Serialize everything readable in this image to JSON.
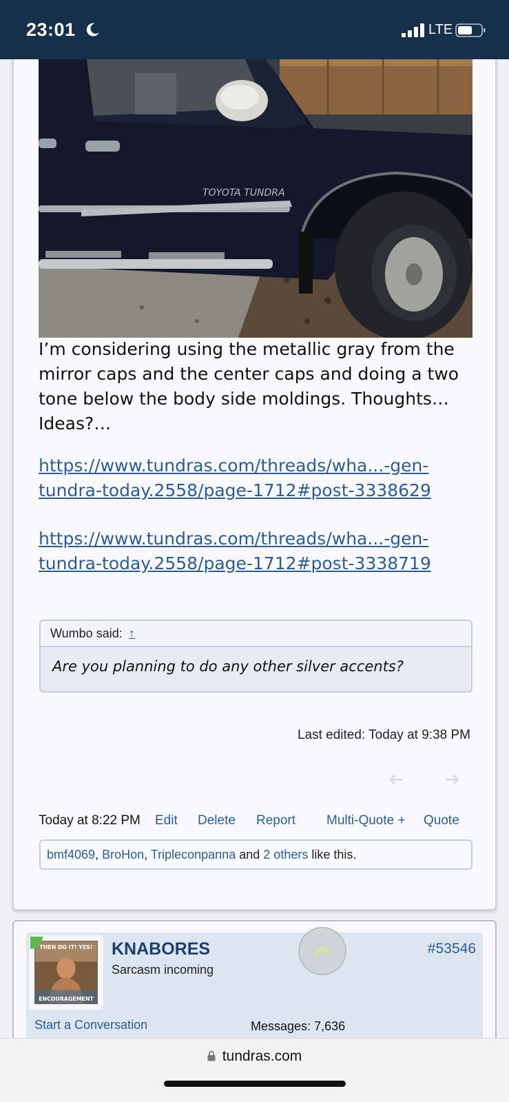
{
  "status_bar": {
    "time": "23:01",
    "network": "LTE"
  },
  "post": {
    "body": "I’m considering using the metallic gray from the mirror caps and the center caps and doing a two tone below the body side moldings. Thoughts… Ideas?…",
    "links": [
      "https://www.tundras.com/threads/wha...-gen-tundra-today.2558/page-1712#post-3338629",
      "https://www.tundras.com/threads/wha...-gen-tundra-today.2558/page-1712#post-3338719"
    ],
    "photo_badge": "TOYOTA TUNDRA",
    "quote": {
      "author_said": "Wumbo said:",
      "arrow": "↑",
      "text": "Are you planning to do any other silver accents?"
    },
    "last_edited": "Last edited: Today at 9:38 PM",
    "footer": {
      "time": "Today at 8:22 PM",
      "edit": "Edit",
      "delete": "Delete",
      "report": "Report",
      "multi_quote": "Multi-Quote +",
      "quote": "Quote"
    },
    "likes": {
      "user1": "bmf4069",
      "user2": "BroHon",
      "user3": "Tripleconpanna",
      "and": "and",
      "others": "2 others",
      "suffix": "like this."
    }
  },
  "next_post": {
    "username": "KNABORES",
    "user_title": "Sarcasm incoming",
    "post_number": "#53546",
    "start_conversation": "Start a Conversation",
    "messages_label": "Messages:",
    "messages_count": "7,636",
    "avatar_text_top": "THEN DO IT! YES!",
    "avatar_text_bottom": "ENCOURAGEMENT"
  },
  "browser": {
    "url": "tundras.com"
  }
}
